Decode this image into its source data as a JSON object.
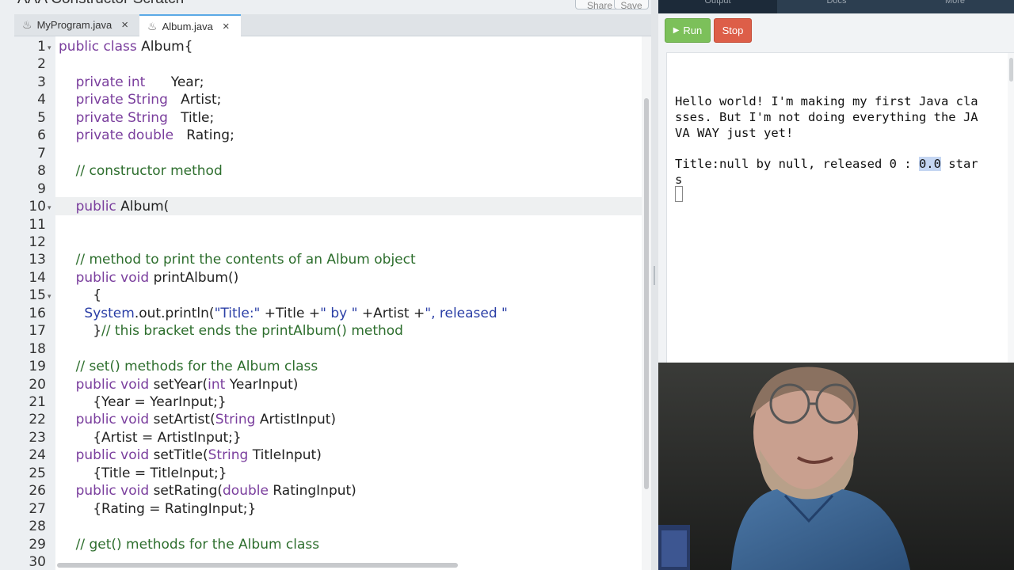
{
  "window": {
    "title": "AAA Constructor Scratch"
  },
  "toolbar": {
    "btn1": "Share",
    "btn2": "Save"
  },
  "tabs": [
    {
      "label": "MyProgram.java",
      "close": "×"
    },
    {
      "label": "Album.java",
      "close": "×"
    }
  ],
  "editor": {
    "line_numbers": [
      "1",
      "2",
      "3",
      "4",
      "5",
      "6",
      "7",
      "8",
      "9",
      "10",
      "11",
      "12",
      "13",
      "14",
      "15",
      "16",
      "17",
      "18",
      "19",
      "20",
      "21",
      "22",
      "23",
      "24",
      "25",
      "26",
      "27",
      "28",
      "29",
      "30"
    ],
    "fold_markers": [
      "1",
      "10",
      "15"
    ],
    "lines": [
      [
        {
          "t": "public class ",
          "c": "kw"
        },
        {
          "t": "Album{",
          "c": ""
        }
      ],
      [],
      [
        {
          "t": "    private int      ",
          "c": "kw"
        },
        {
          "t": "Year;",
          "c": ""
        }
      ],
      [
        {
          "t": "    private String   ",
          "c": "kw"
        },
        {
          "t": "Artist;",
          "c": ""
        }
      ],
      [
        {
          "t": "    private String   ",
          "c": "kw"
        },
        {
          "t": "Title;",
          "c": ""
        }
      ],
      [
        {
          "t": "    private double   ",
          "c": "kw"
        },
        {
          "t": "Rating;",
          "c": ""
        }
      ],
      [],
      [
        {
          "t": "    // constructor method",
          "c": "cm"
        }
      ],
      [],
      [
        {
          "t": "    public ",
          "c": "kw"
        },
        {
          "t": "Album(",
          "c": ""
        }
      ],
      [],
      [],
      [
        {
          "t": "    // method to print the contents of an Album object",
          "c": "cm"
        }
      ],
      [
        {
          "t": "    public void ",
          "c": "kw"
        },
        {
          "t": "printAlbum()",
          "c": ""
        }
      ],
      [
        {
          "t": "        {",
          "c": ""
        }
      ],
      [
        {
          "t": "      System",
          "c": "st"
        },
        {
          "t": ".out.println(",
          "c": ""
        },
        {
          "t": "\"Title:\"",
          "c": "st"
        },
        {
          "t": " +Title +",
          "c": ""
        },
        {
          "t": "\" by \"",
          "c": "st"
        },
        {
          "t": " +Artist +",
          "c": ""
        },
        {
          "t": "\", released \"",
          "c": "st"
        }
      ],
      [
        {
          "t": "        }",
          "c": ""
        },
        {
          "t": "// this bracket ends the printAlbum() method",
          "c": "cm"
        }
      ],
      [],
      [
        {
          "t": "    // set() methods for the Album class",
          "c": "cm"
        }
      ],
      [
        {
          "t": "    public void ",
          "c": "kw"
        },
        {
          "t": "setYear(",
          "c": ""
        },
        {
          "t": "int ",
          "c": "kw"
        },
        {
          "t": "YearInput)",
          "c": ""
        }
      ],
      [
        {
          "t": "        {Year = YearInput;}",
          "c": ""
        }
      ],
      [
        {
          "t": "    public void ",
          "c": "kw"
        },
        {
          "t": "setArtist(",
          "c": ""
        },
        {
          "t": "String ",
          "c": "kw"
        },
        {
          "t": "ArtistInput)",
          "c": ""
        }
      ],
      [
        {
          "t": "        {Artist = ArtistInput;}",
          "c": ""
        }
      ],
      [
        {
          "t": "    public void ",
          "c": "kw"
        },
        {
          "t": "setTitle(",
          "c": ""
        },
        {
          "t": "String ",
          "c": "kw"
        },
        {
          "t": "TitleInput)",
          "c": ""
        }
      ],
      [
        {
          "t": "        {Title = TitleInput;}",
          "c": ""
        }
      ],
      [
        {
          "t": "    public void ",
          "c": "kw"
        },
        {
          "t": "setRating(",
          "c": ""
        },
        {
          "t": "double ",
          "c": "kw"
        },
        {
          "t": "RatingInput)",
          "c": ""
        }
      ],
      [
        {
          "t": "        {Rating = RatingInput;}",
          "c": ""
        }
      ],
      [],
      [
        {
          "t": "    // get() methods for the Album class",
          "c": "cm"
        }
      ],
      []
    ]
  },
  "run_panel": {
    "tabs": [
      "Output",
      "Docs",
      "More"
    ],
    "run_label": "Run",
    "stop_label": "Stop",
    "run_icon": "play-icon",
    "output_lines": [
      "Hello world! I'm making my first Java cla",
      "sses. But I'm not doing everything the JA",
      "VA WAY just yet!",
      "",
      "Title:null by null, released 0 : ",
      "s"
    ],
    "highlighted": "0.0",
    "after_highlight": " star"
  },
  "colors": {
    "keyword": "#7a3e9d",
    "comment": "#2d6e2d",
    "string": "#2b3fa6",
    "run": "#7cc05a",
    "stop": "#dd5e48",
    "tab_bar": "#2c3e50"
  }
}
